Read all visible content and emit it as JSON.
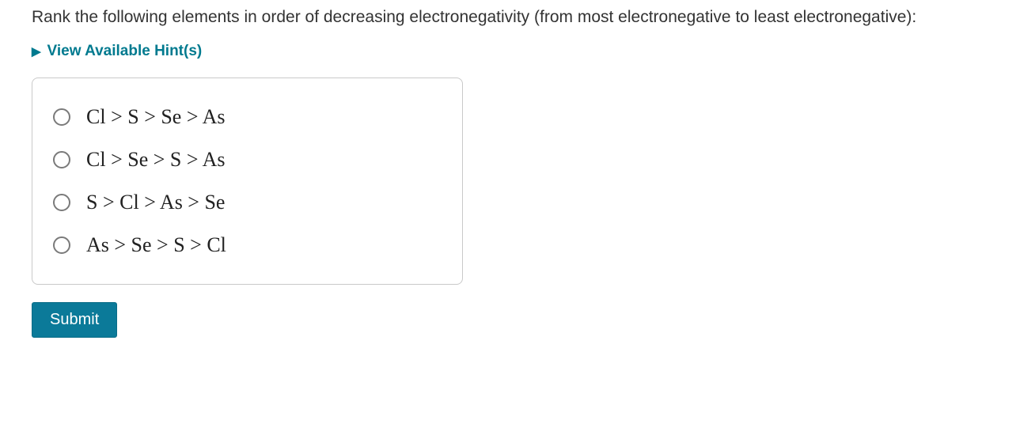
{
  "question": "Rank the following elements in order of decreasing electronegativity (from most electronegative to least electronegative):",
  "hints": {
    "label": "View Available Hint(s)"
  },
  "options": [
    {
      "label": "Cl > S > Se > As"
    },
    {
      "label": "Cl > Se > S > As"
    },
    {
      "label": "S > Cl > As > Se"
    },
    {
      "label": "As > Se > S > Cl"
    }
  ],
  "submit": {
    "label": "Submit"
  },
  "colors": {
    "accent": "#0b7a99",
    "hintLink": "#007a8f"
  }
}
